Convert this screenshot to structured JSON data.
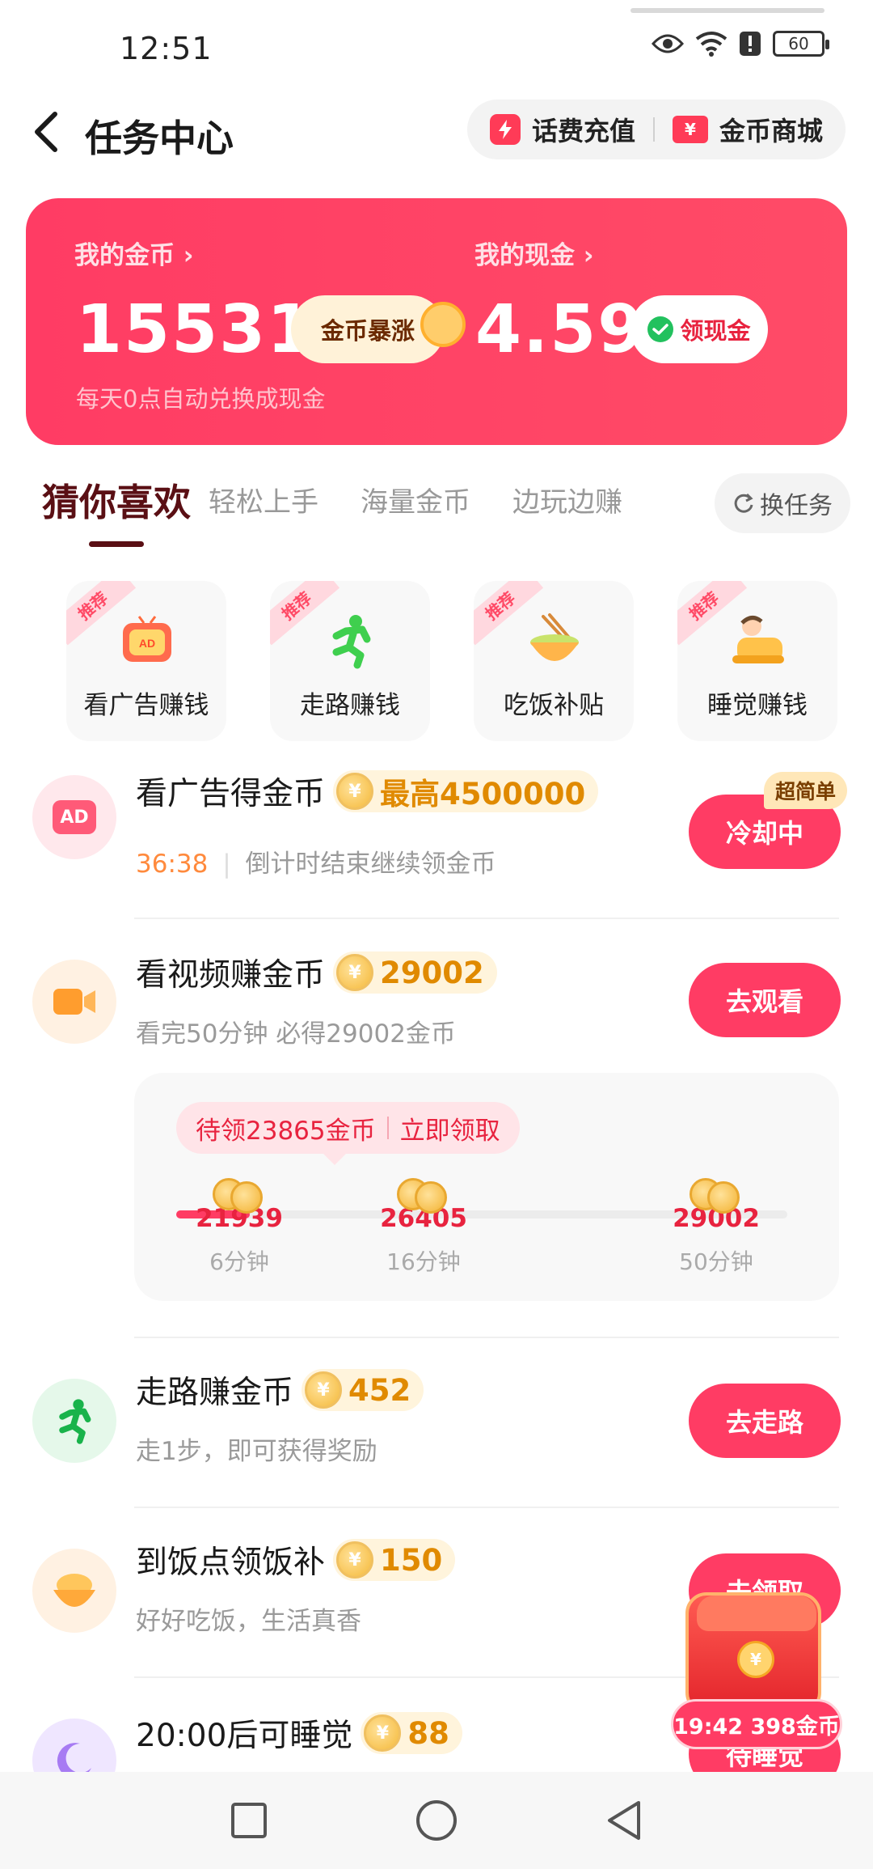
{
  "status": {
    "time": "12:51",
    "battery": "60"
  },
  "header": {
    "title": "任务中心",
    "recharge_label": "话费充值",
    "mall_label": "金币商城",
    "mall_icon_glyph": "¥"
  },
  "wallet": {
    "coin_label": "我的金币",
    "coin_value": "15531",
    "surge_label": "金币暴涨",
    "cash_label": "我的现金",
    "cash_value": "4.59",
    "withdraw_label": "领现金",
    "note": "每天0点自动兑换成现金"
  },
  "tabs": {
    "items": [
      "猜你喜欢",
      "轻松上手",
      "海量金币",
      "边玩边赚"
    ],
    "active": "猜你喜欢",
    "swap_label": "换任务"
  },
  "categories": [
    {
      "tag": "推荐",
      "label": "看广告赚钱",
      "icon": "tv-ad-icon"
    },
    {
      "tag": "推荐",
      "label": "走路赚钱",
      "icon": "running-man-icon"
    },
    {
      "tag": "推荐",
      "label": "吃饭补贴",
      "icon": "food-bowl-icon"
    },
    {
      "tag": "推荐",
      "label": "睡觉赚钱",
      "icon": "sleeping-person-icon"
    }
  ],
  "tasks": [
    {
      "title": "看广告得金币",
      "coin_text": "最高4500000",
      "timer": "36:38",
      "sub": "倒计时结束继续领金币",
      "button": "冷却中",
      "badge": "超简单",
      "icon_text": "AD",
      "coin_glyph": "¥"
    },
    {
      "title": "看视频赚金币",
      "coin_text": "29002",
      "sub": "看完50分钟 必得29002金币",
      "button": "去观看",
      "coin_glyph": "¥"
    },
    {
      "title": "走路赚金币",
      "coin_text": "452",
      "sub": "走1步，即可获得奖励",
      "button": "去走路",
      "coin_glyph": "¥"
    },
    {
      "title": "到饭点领饭补",
      "coin_text": "150",
      "sub": "好好吃饭，生活真香",
      "button": "去领取",
      "coin_glyph": "¥"
    },
    {
      "title": "20:00后可睡觉",
      "coin_text": "88",
      "button": "待睡觉",
      "coin_glyph": "¥"
    }
  ],
  "video_progress": {
    "pending_text": "待领23865金币",
    "claim_text": "立即领取",
    "progress_fraction": 0.12,
    "milestones": [
      {
        "value": "21939",
        "time": "6分钟"
      },
      {
        "value": "26405",
        "time": "16分钟"
      },
      {
        "value": "29002",
        "time": "50分钟"
      }
    ]
  },
  "floating_packet": {
    "text": "19:42 398金币",
    "coin_glyph": "¥"
  },
  "colors": {
    "accent": "#ff3c64",
    "coin": "#e08a00",
    "tab_active": "#5a0f14"
  }
}
